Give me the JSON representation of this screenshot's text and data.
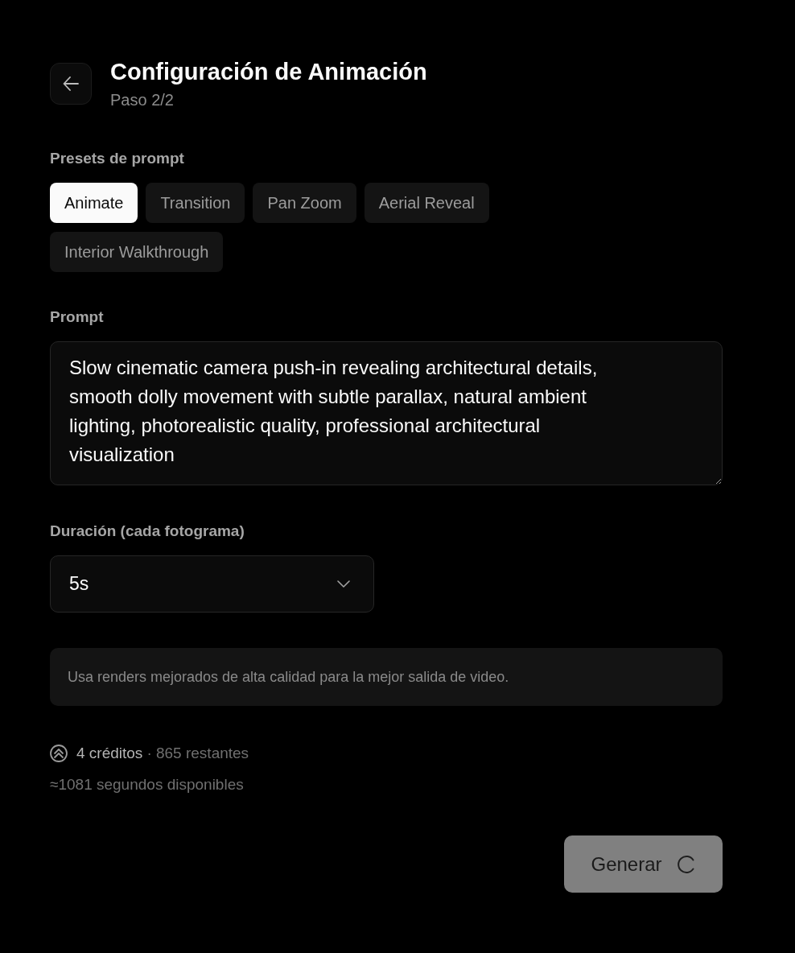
{
  "header": {
    "title": "Configuración de Animación",
    "subtitle": "Paso 2/2"
  },
  "presets": {
    "label": "Presets de prompt",
    "items": [
      {
        "label": "Animate",
        "selected": true
      },
      {
        "label": "Transition",
        "selected": false
      },
      {
        "label": "Pan Zoom",
        "selected": false
      },
      {
        "label": "Aerial Reveal",
        "selected": false
      },
      {
        "label": "Interior Walkthrough",
        "selected": false
      }
    ]
  },
  "prompt": {
    "label": "Prompt",
    "value": "Slow cinematic camera push-in revealing architectural details, smooth dolly movement with subtle parallax, natural ambient lighting, photorealistic quality, professional architectural visualization"
  },
  "duration": {
    "label": "Duración (cada fotograma)",
    "value": "5s"
  },
  "info": "Usa renders mejorados de alta calidad para la mejor salida de video.",
  "credits": {
    "cost": "4 créditos",
    "remaining": "· 865 restantes",
    "seconds": "≈1081 segundos disponibles"
  },
  "generate_button": {
    "label": "Generar",
    "disabled": true,
    "loading": true
  }
}
